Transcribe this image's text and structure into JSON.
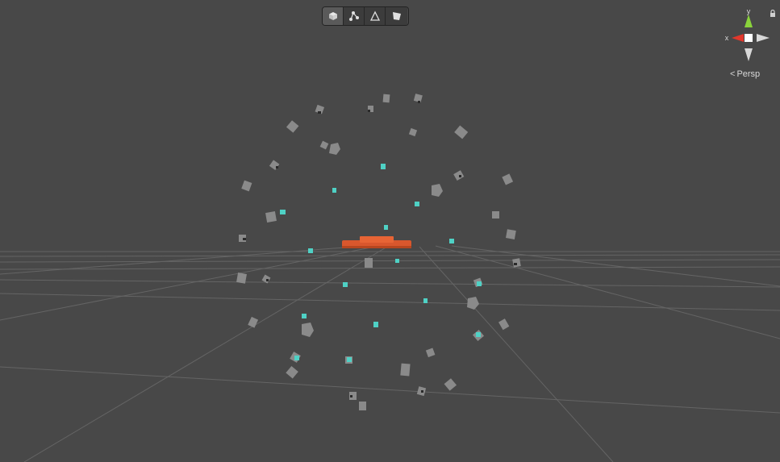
{
  "scene_view": {
    "toolbar": {
      "tools": [
        {
          "name": "shaded",
          "icon": "cube-icon",
          "active": true
        },
        {
          "name": "wireframe-vertices",
          "icon": "vertex-graph-icon",
          "active": false
        },
        {
          "name": "edges",
          "icon": "edge-tool-icon",
          "active": false
        },
        {
          "name": "faces",
          "icon": "face-tool-icon",
          "active": false
        }
      ]
    },
    "orientation_gizmo": {
      "x_label": "x",
      "y_label": "y",
      "x_color": "#e2372b",
      "y_color": "#8ad33b",
      "center_color": "#ffffff"
    },
    "projection_label": "Persp",
    "colors": {
      "background": "#484848",
      "grid": "#6e6e6e",
      "platform": "#d85a2e",
      "camera_body": "#8a8a8a",
      "camera_accent": "#4fd1c5"
    }
  }
}
